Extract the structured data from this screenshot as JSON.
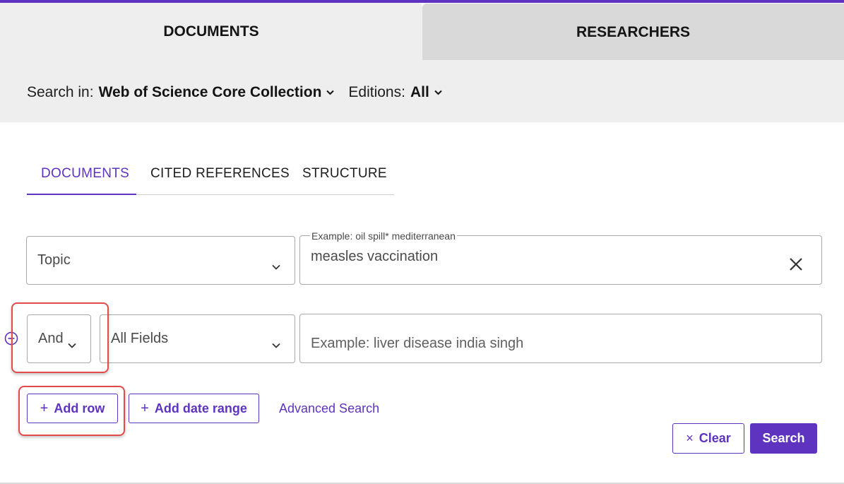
{
  "main_tabs": [
    {
      "label": "DOCUMENTS",
      "active": true
    },
    {
      "label": "RESEARCHERS",
      "active": false
    }
  ],
  "search_in": {
    "label": "Search in:",
    "collection": "Web of Science Core Collection",
    "editions_label": "Editions:",
    "editions_value": "All"
  },
  "sub_tabs": [
    {
      "label": "DOCUMENTS",
      "active": true
    },
    {
      "label": "CITED REFERENCES",
      "active": false
    },
    {
      "label": "STRUCTURE",
      "active": false
    }
  ],
  "rows": [
    {
      "field": "Topic",
      "input_label": "Example: oil spill* mediterranean",
      "input_value": "measles vaccination"
    },
    {
      "operator": "And",
      "field": "All Fields",
      "input_placeholder": "Example: liver disease india singh"
    }
  ],
  "actions": {
    "add_row": "Add row",
    "add_date_range": "Add date range",
    "advanced_search": "Advanced Search",
    "clear": "Clear",
    "search": "Search"
  },
  "colors": {
    "accent": "#5e33bf",
    "tab_band": "#eeeeee",
    "inactive_tab": "#d9d9d9",
    "annotation": "#e34a4a"
  },
  "icons": [
    "chevron-down-icon",
    "close-icon",
    "circle-minus-icon",
    "plus-icon"
  ]
}
